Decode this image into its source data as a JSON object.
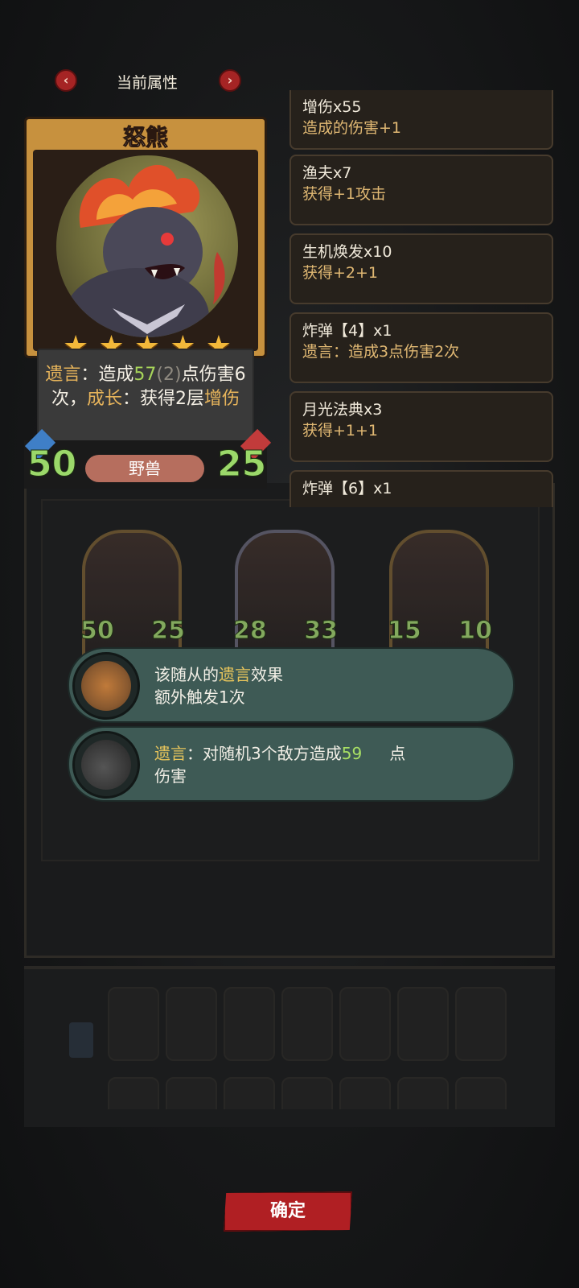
{
  "header": {
    "title": "当前属性",
    "prev_icon": "‹",
    "next_icon": "›"
  },
  "card": {
    "name": "怒熊",
    "stars": 5,
    "description": {
      "kw1": "遗言",
      "t1": "：造成",
      "dmg": "57",
      "dmg_bonus": "(2)",
      "t2": "点伤害6次，",
      "kw2": "成长",
      "t3": "：获得2层",
      "kw3": "增伤"
    },
    "attack": "50",
    "health": "25",
    "tribe": "野兽"
  },
  "buffs": [
    {
      "name": "增伤x55",
      "desc": "造成的伤害+1"
    },
    {
      "name": "渔夫x7",
      "desc": "获得+1攻击"
    },
    {
      "name": "生机焕发x10",
      "desc": "获得+2+1"
    },
    {
      "name": "炸弹【4】x1",
      "desc": "遗言：造成3点伤害2次"
    },
    {
      "name": "月光法典x3",
      "desc": "获得+1+1"
    },
    {
      "name": "炸弹【6】x1",
      "desc": ""
    }
  ],
  "minions": [
    {
      "attack": "50",
      "health": "25"
    },
    {
      "attack": "28",
      "health": "33"
    },
    {
      "attack": "15",
      "health": "10"
    }
  ],
  "tooltips": [
    {
      "pre": "该随从的",
      "kw": "遗言",
      "post": "效果",
      "line2": "额外触发1次",
      "icon": "skull-gear-icon"
    },
    {
      "kw": "遗言",
      "pre": "：对随机3个敌方造成",
      "num": "59",
      "post": "点",
      "line2": "伤害",
      "icon": "bomb-icon"
    }
  ],
  "confirm_label": "确定"
}
